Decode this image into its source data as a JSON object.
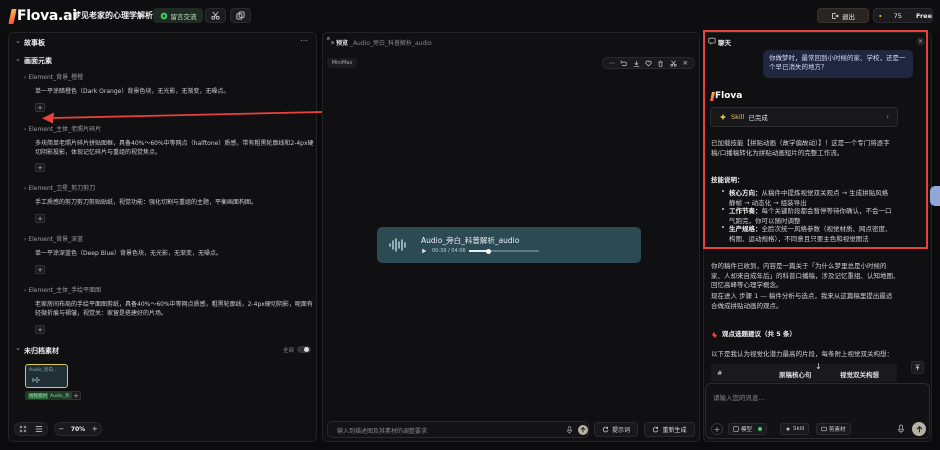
{
  "app": {
    "logo": "Flova.ai",
    "project_title": "梦见老家的心理学解析"
  },
  "topbar": {
    "share_label": "留言交流",
    "logout_label": "退出",
    "credits": "75",
    "plan": "Free"
  },
  "storyboard": {
    "header": "故事板",
    "section_title": "画面元素",
    "elements": [
      {
        "title": "Element_背景_橙橙",
        "desc": [
          "单一平涂暗橙色（Dark Orange）背景色块，无光影，无渐变，无噪点。"
        ]
      },
      {
        "title": "Element_主体_老照片碎片",
        "desc": [
          "多块简单老照片碎片拼贴图框，具备40%～60%中等网点（halftone）质感，带有粗黑轮廓线和2-4px硬",
          "切阴影投影，体现记忆碎片与重组的视觉焦点。"
        ]
      },
      {
        "title": "Element_卫星_剪刀剪刀",
        "desc": [
          "手工质感的剪刀剪刀剪贴贴纸，视觉功能：强化切割与重组的主题，平衡画面构图。"
        ]
      },
      {
        "title": "Element_背景_深蓝",
        "desc": [
          "单一平涂深蓝色（Deep Blue）背景色块，无光影，无渐变，无噪点。"
        ]
      },
      {
        "title": "Element_主体_手绘平面图",
        "desc": [
          "老家房间布局的手绘平面图剪纸，具备40%～60%中等网点质感，粗黑轮廓线，2-4px硬切阴影，呢面有",
          "轻微折痕与褶皱，视觉关：家留是搭建好的片场。"
        ]
      }
    ],
    "unclassified_header": "未归档素材",
    "toggle_label": "全部",
    "asset_thumb_label": "Audio_旁白...",
    "asset_tag_label": "视频素材",
    "asset_tag_name": "Audio_旁...",
    "zoom": "70%"
  },
  "preview": {
    "header_prefix": "预览",
    "header_file": "Audio_旁白_科普解析_audio",
    "model_tag": "MiniMax",
    "audio_title": "Audio_旁白_科普解析_audio",
    "audio_time": "00:39 / 04:06",
    "audio_progress": 0.28,
    "input_placeholder": "输入到描述图及其素材的调整要求",
    "tips_label": "提示词",
    "regen_label": "重新生成"
  },
  "chat": {
    "header": "聊天",
    "user_message": "你做梦时，最常回到小时候的家、学校，还是一个早已消失的地方？",
    "bot_name": "Flova",
    "skill_label": "Skill",
    "skill_status": "已完成",
    "p1": [
      "已加载技能【拼贴动画（故学偏故动）】！这是一个专门将逐字",
      "稿/口播稿转化为拼贴动画短片的完整工作流。"
    ],
    "tips_title": "技能说明：",
    "bullets": [
      {
        "label": "核心方向：",
        "lines": [
          "从稿件中提炼视觉双关观点 → 生成拼贴风格",
          "静帧 → 动态化 → 组装导出"
        ]
      },
      {
        "label": "工作节奏：",
        "lines": [
          "每个关键阶段都会暂停等待你确认，不会一口",
          "气跑完，你可以随时调整"
        ]
      },
      {
        "label": "生产规格：",
        "lines": [
          "全脸次统一风格参数（视觉材质、网点密度、",
          "构图、运动规格），不同意且只要主色和视觉图法"
        ]
      }
    ],
    "p2": [
      "你的稿件已收到，内容是一篇关于「为什么梦里总是小时候的",
      "家、人却来自成年后」的科普口播稿，涉及记忆重组、认知地图、",
      "回忆高峰等心理学概念。"
    ],
    "p3": [
      "现在进入 步骤 1 — 稿件分析与选点，我来从这篇稿里提出最适",
      "合做成拼贴动画的观点。"
    ],
    "sect_title": "观点选题建议（共 5 条）",
    "sect_desc": "以下是我认为视觉化潜力最高的片段，每条附上视觉双关构想：",
    "table_headers": [
      "#",
      "原稿核心句",
      "视觉双关构想"
    ],
    "input_placeholder": "请输入您的讯息...",
    "tool_model": "模型",
    "tool_skill": "Skill",
    "tool_clip": "剪素材"
  },
  "colors": {
    "accent_red": "#e8413e",
    "audio_bg": "#2c4a52",
    "bubble_bg": "#1f2640"
  }
}
